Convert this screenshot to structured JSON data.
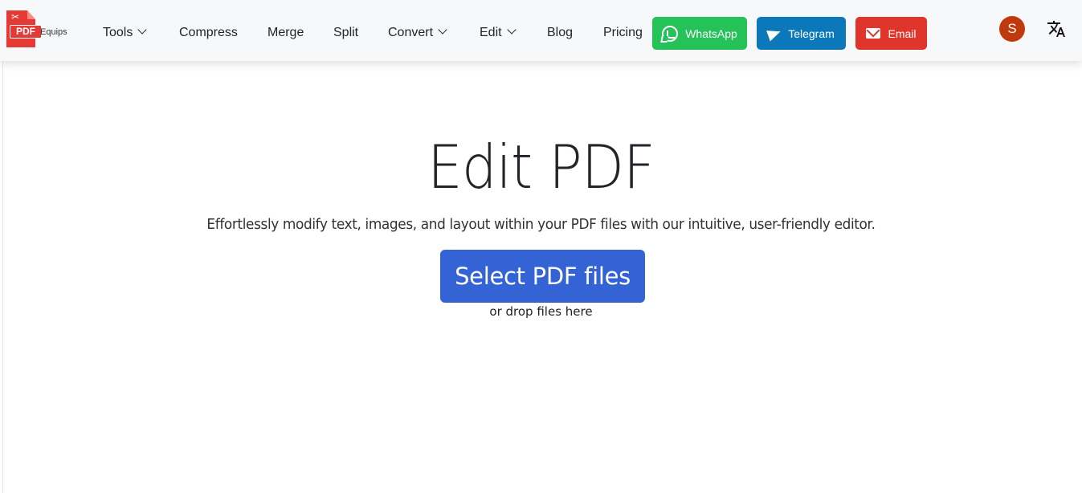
{
  "brand": {
    "badge": "PDF",
    "name": "Equips"
  },
  "nav": {
    "tools": "Tools",
    "compress": "Compress",
    "merge": "Merge",
    "split": "Split",
    "convert": "Convert",
    "edit": "Edit",
    "blog": "Blog",
    "pricing": "Pricing"
  },
  "contact": {
    "whatsapp": "WhatsApp",
    "telegram": "Telegram",
    "email": "Email",
    "colors": {
      "whatsapp": "#25c25a",
      "telegram": "#0a78b9",
      "email": "#e0352b"
    }
  },
  "user": {
    "avatar_initial": "S",
    "avatar_color": "#c0390d"
  },
  "icons": {
    "language": "translate-icon",
    "chevron": "chevron-down-icon"
  },
  "hero": {
    "title": "Edit PDF",
    "subtitle": "Effortlessly modify text, images, and layout within your PDF files with our intuitive, user-friendly editor.",
    "select_button": "Select PDF files",
    "drop_hint": "or drop files here",
    "button_color": "#3463d6"
  }
}
